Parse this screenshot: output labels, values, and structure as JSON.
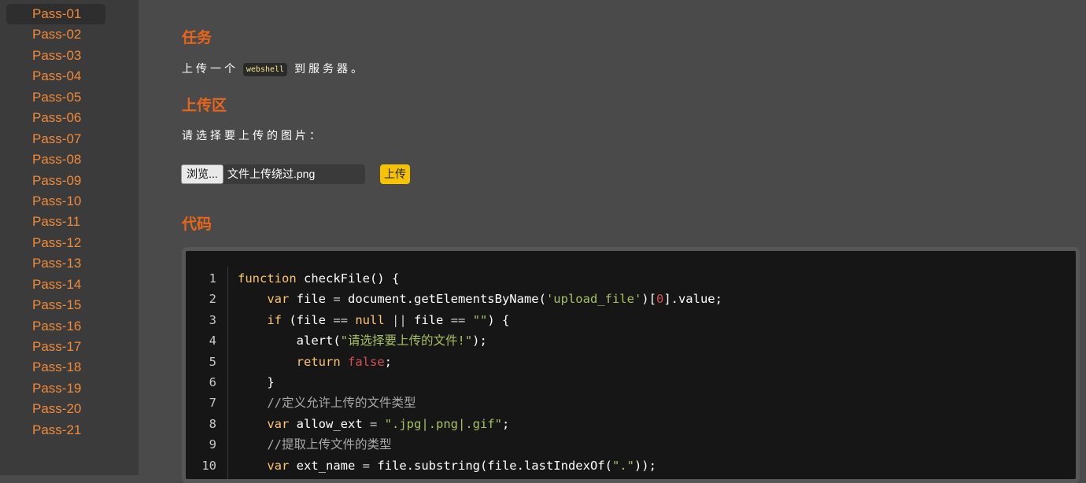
{
  "sidebar": {
    "items": [
      "Pass-01",
      "Pass-02",
      "Pass-03",
      "Pass-04",
      "Pass-05",
      "Pass-06",
      "Pass-07",
      "Pass-08",
      "Pass-09",
      "Pass-10",
      "Pass-11",
      "Pass-12",
      "Pass-13",
      "Pass-14",
      "Pass-15",
      "Pass-16",
      "Pass-17",
      "Pass-18",
      "Pass-19",
      "Pass-20",
      "Pass-21"
    ],
    "active_index": 0
  },
  "task": {
    "title": "任务",
    "text_before": "上传一个",
    "tag": "webshell",
    "text_after": "到服务器。"
  },
  "upload": {
    "title": "上传区",
    "prompt": "请选择要上传的图片：",
    "browse_label": "浏览...",
    "file_name": "文件上传绕过.png",
    "submit_label": "上传"
  },
  "code": {
    "title": "代码",
    "colors": {
      "keyword": "#ffc66d",
      "string": "#a5c261",
      "number": "#d25252",
      "comment": "#aaaaaa"
    },
    "lines": [
      {
        "n": "1",
        "tokens": [
          [
            "kw",
            "function"
          ],
          [
            "plain",
            " checkFile() {"
          ]
        ]
      },
      {
        "n": "2",
        "tokens": [
          [
            "plain",
            "    "
          ],
          [
            "kw",
            "var"
          ],
          [
            "plain",
            " file "
          ],
          [
            "op",
            "="
          ],
          [
            "plain",
            " document.getElementsByName("
          ],
          [
            "str",
            "'upload_file'"
          ],
          [
            "plain",
            ")["
          ],
          [
            "num",
            "0"
          ],
          [
            "plain",
            "].value;"
          ]
        ]
      },
      {
        "n": "3",
        "tokens": [
          [
            "plain",
            "    "
          ],
          [
            "kw",
            "if"
          ],
          [
            "plain",
            " (file "
          ],
          [
            "op",
            "=="
          ],
          [
            "plain",
            " "
          ],
          [
            "kw",
            "null"
          ],
          [
            "plain",
            " "
          ],
          [
            "op",
            "||"
          ],
          [
            "plain",
            " file "
          ],
          [
            "op",
            "=="
          ],
          [
            "plain",
            " "
          ],
          [
            "str",
            "\"\""
          ],
          [
            "plain",
            ") {"
          ]
        ]
      },
      {
        "n": "4",
        "tokens": [
          [
            "plain",
            "        alert("
          ],
          [
            "str",
            "\"请选择要上传的文件!\""
          ],
          [
            "plain",
            ");"
          ]
        ]
      },
      {
        "n": "5",
        "tokens": [
          [
            "plain",
            "        "
          ],
          [
            "kw",
            "return"
          ],
          [
            "plain",
            " "
          ],
          [
            "lit",
            "false"
          ],
          [
            "plain",
            ";"
          ]
        ]
      },
      {
        "n": "6",
        "tokens": [
          [
            "plain",
            "    }"
          ]
        ]
      },
      {
        "n": "7",
        "tokens": [
          [
            "plain",
            "    "
          ],
          [
            "cm",
            "//定义允许上传的文件类型"
          ]
        ]
      },
      {
        "n": "8",
        "tokens": [
          [
            "plain",
            "    "
          ],
          [
            "kw",
            "var"
          ],
          [
            "plain",
            " allow_ext "
          ],
          [
            "op",
            "="
          ],
          [
            "plain",
            " "
          ],
          [
            "str",
            "\".jpg|.png|.gif\""
          ],
          [
            "plain",
            ";"
          ]
        ]
      },
      {
        "n": "9",
        "tokens": [
          [
            "plain",
            "    "
          ],
          [
            "cm",
            "//提取上传文件的类型"
          ]
        ]
      },
      {
        "n": "10",
        "tokens": [
          [
            "plain",
            "    "
          ],
          [
            "kw",
            "var"
          ],
          [
            "plain",
            " ext_name "
          ],
          [
            "op",
            "="
          ],
          [
            "plain",
            " file.substring(file.lastIndexOf("
          ],
          [
            "str",
            "\".\""
          ],
          [
            "plain",
            "));"
          ]
        ]
      }
    ]
  }
}
